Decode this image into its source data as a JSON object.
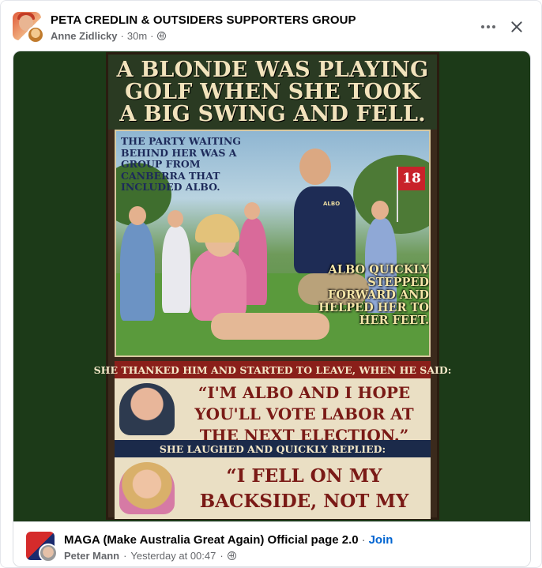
{
  "header": {
    "group_name": "PETA CREDLIN & OUTSIDERS SUPPORTERS GROUP",
    "author": "Anne Zidlicky",
    "time": "30m",
    "separator": "·",
    "privacy_icon": "globe-icon"
  },
  "actions": {
    "more_icon": "more-icon",
    "close_icon": "close-icon"
  },
  "poster": {
    "title": "A BLONDE WAS PLAYING GOLF WHEN SHE TOOK A BIG SWING AND FELL.",
    "caption_left": "THE PARTY WAITING BEHIND HER WAS A GROUP FROM CANBERRA THAT INCLUDED ALBO.",
    "flag_number": "18",
    "shirt_text": "ALBO",
    "caption_right": "ALBO QUICKLY STEPPED FORWARD AND HELPED HER TO HER FEET.",
    "bar1": "SHE THANKED HIM AND STARTED TO LEAVE, WHEN HE SAID:",
    "quote1": "“I'M ALBO AND I HOPE YOU'LL VOTE LABOR AT THE NEXT ELECTION.”",
    "bar2": "SHE LAUGHED AND QUICKLY REPLIED:",
    "quote2": "“I FELL ON MY BACKSIDE, NOT MY HEAD!”"
  },
  "source": {
    "page_name": "MAGA (Make Australia Great Again) Official page 2.0",
    "separator": "·",
    "join_label": "Join",
    "sharer": "Peter Mann",
    "time": "Yesterday at 00:47",
    "privacy_icon": "globe-icon"
  },
  "colors": {
    "link_blue": "#0064d1",
    "meta_gray": "#65676b",
    "poster_red": "#8a1f1a",
    "poster_navy": "#1b2a4a",
    "image_bg": "#1c3a18"
  }
}
